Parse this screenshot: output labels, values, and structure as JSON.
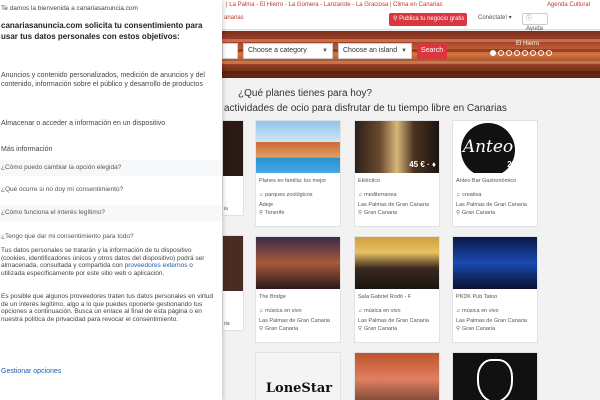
{
  "topbar": {
    "islands": "| La Palma - El Hierro - La Gomera - Lanzarote - La Graciosa | Clima en Canarias",
    "cultural": "Agenda Cultural"
  },
  "navbar": {
    "canarias": "anarias",
    "publish_button": "Publica tu negocio gratis",
    "connect": "Conéctate! ▾",
    "help": "Ayuda"
  },
  "search": {
    "category_placeholder": "Choose a category",
    "island_placeholder": "Choose an island",
    "button": "Search"
  },
  "hero": {
    "label": "El Hierro",
    "slides": 8,
    "active_slide": 1
  },
  "main": {
    "title": "¿Qué planes tienes para hoy?",
    "subtitle": "actividades de ocio para disfrutar de tu tiempo libre en Canarias"
  },
  "left_cards": [
    {
      "text": "ia"
    },
    {
      "text": "ria"
    }
  ],
  "cards": [
    {
      "name": "Planes en familia: los mejor",
      "category": "parques zoológicos",
      "city": "Adeje",
      "island": "Tenerife",
      "image": "colorful-resort-pool"
    },
    {
      "name": "Ekléctico",
      "category": "mediterranea",
      "city": "Las Palmas de Gran Canaria",
      "island": "Gran Canaria",
      "image": "restaurant-bar",
      "price": "45 € · ♦"
    },
    {
      "name": "Anteo Bar Gastronómico",
      "category": "creativa",
      "city": "Las Palmas de Gran Canaria",
      "island": "Gran Canaria",
      "image": "anteo-logo",
      "logo_text": "Anteo",
      "price": "25 € · ♦"
    },
    {
      "name": "The Bridge",
      "category": "música en vivo",
      "city": "Las Palmas de Gran Canaria",
      "island": "Gran Canaria",
      "image": "concert-stage"
    },
    {
      "name": "Sala Gabriel Rodó - F",
      "category": "música en vivo",
      "city": "Las Palmas de Gran Canaria",
      "island": "Gran Canaria",
      "image": "concert-hall"
    },
    {
      "name": "PKDK Pub Tatoo",
      "category": "música en vivo",
      "city": "Las Palmas de Gran Canaria",
      "island": "Gran Canaria",
      "image": "blue-stage"
    },
    {
      "name": "",
      "category": "",
      "city": "",
      "island": "",
      "image": "lone-star-logo",
      "logo_text": "LoneStar"
    },
    {
      "name": "",
      "category": "",
      "city": "",
      "island": "",
      "image": "old-street"
    },
    {
      "name": "",
      "category": "",
      "city": "",
      "island": "",
      "image": "wolf-logo"
    }
  ],
  "consent": {
    "welcome": "Te damos la bienvenida a canariasanuncia.com",
    "heading": "canariasanuncia.com solicita tu consentimiento para usar tus datos personales con estos objetivos:",
    "purposes": "Anuncios y contenido personalizados, medición de anuncios y del contenido, información sobre el público y desarrollo de productos",
    "device": "Almacenar o acceder a información en un dispositivo",
    "more_info": "Más información",
    "faqs": [
      "¿Cómo puedo cambiar la opción elegida?",
      "¿Qué ocurre si no doy mi consentimiento?",
      "¿Cómo funciona el interés legítimo?",
      "¿Tengo que dar mi consentimiento para todo?"
    ],
    "data_text_1": "Tus datos personales se tratarán y la información de tu dispositivo (cookies, identificadores únicos y otros datos del dispositivo) podrá ser almacenada, consultada y compartida con",
    "data_link": "proveedores externos",
    "data_text_2": "o utilizada específicamente por este sitio web o aplicación.",
    "legit_text": "Es posible que algunos proveedores traten tus datos personales en virtud de un interés legítimo, algo a lo que puedes oponerte gestionando tus opciones a continuación. Busca un enlace al final de esta página o en nuestra política de privacidad para revocar el consentimiento.",
    "manage_options": "Gestionar opciones"
  },
  "colors": {
    "brand_red": "#d9363e",
    "link_blue": "#1a5ea8"
  }
}
